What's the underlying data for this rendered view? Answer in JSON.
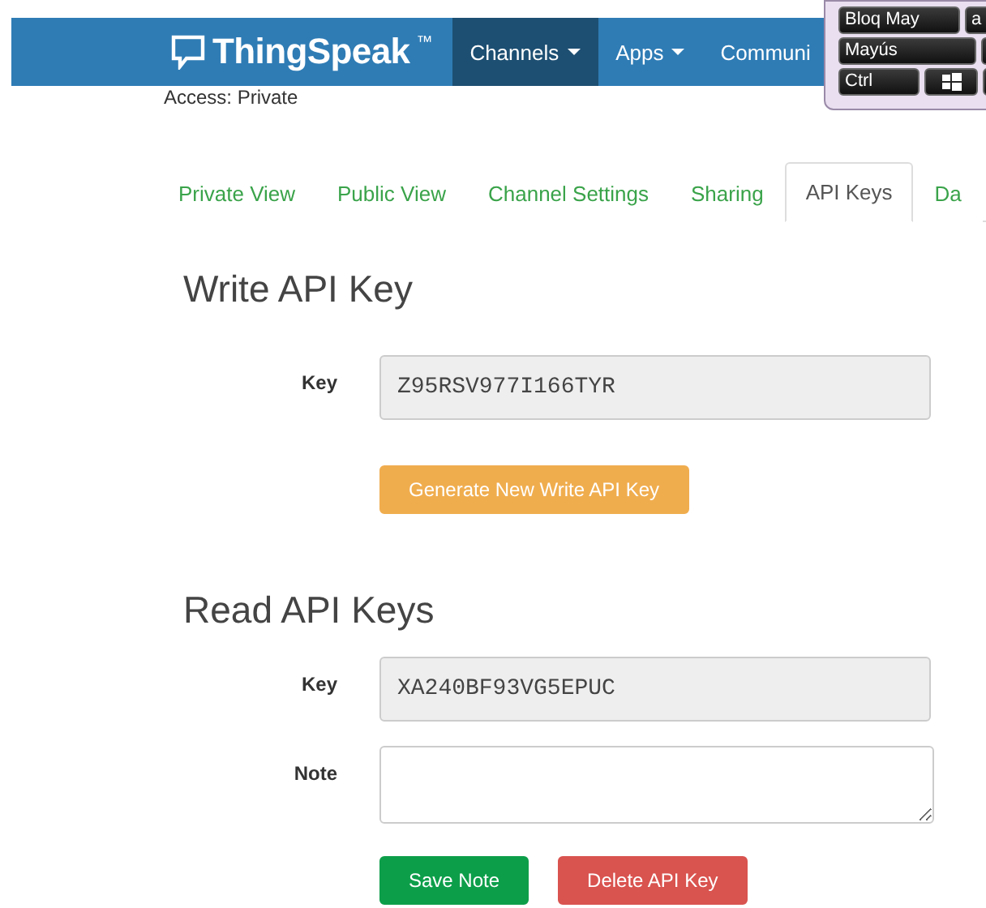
{
  "header": {
    "logo": "ThingSpeak",
    "trademark": "™",
    "nav": [
      {
        "label": "Channels",
        "selected": true,
        "dropdown": true
      },
      {
        "label": "Apps",
        "selected": false,
        "dropdown": true
      },
      {
        "label": "Communi",
        "selected": false,
        "dropdown": false
      }
    ]
  },
  "access": "Access: Private",
  "tabs": [
    {
      "label": "Private View",
      "selected": false
    },
    {
      "label": "Public View",
      "selected": false
    },
    {
      "label": "Channel Settings",
      "selected": false
    },
    {
      "label": "Sharing",
      "selected": false
    },
    {
      "label": "API Keys",
      "selected": true
    },
    {
      "label": "Da",
      "selected": false
    }
  ],
  "sections": [
    {
      "title": "Write API Key",
      "fields": [
        {
          "kind": "input",
          "label": "Key",
          "value": "Z95RSV977I166TYR"
        }
      ],
      "buttons": [
        {
          "label": "Generate New Write API Key"
        }
      ]
    },
    {
      "title": "Read API Keys",
      "fields": [
        {
          "kind": "input",
          "label": "Key",
          "value": "XA240BF93VG5EPUC"
        },
        {
          "kind": "textarea",
          "label": "Note"
        }
      ],
      "buttons": [
        {
          "label": "Save Note"
        },
        {
          "label": "Delete API Key"
        }
      ]
    }
  ],
  "keyboard": {
    "rows": [
      [
        {
          "kind": "text",
          "label": "Bloq May"
        },
        {
          "kind": "text",
          "label": "a"
        }
      ],
      [
        {
          "kind": "text",
          "label": "Mayús"
        },
        {
          "kind": "blank"
        }
      ],
      [
        {
          "kind": "text",
          "label": "Ctrl"
        },
        {
          "kind": "windows"
        },
        {
          "kind": "blank"
        }
      ]
    ]
  }
}
